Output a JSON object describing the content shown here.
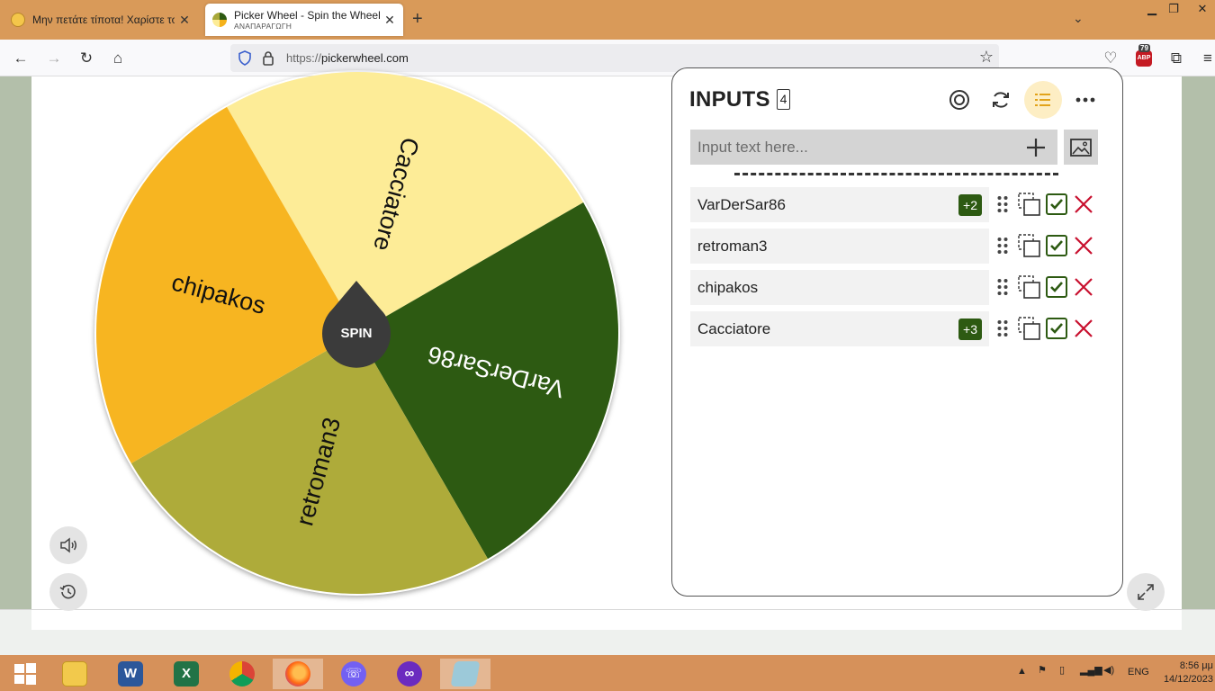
{
  "browser": {
    "tabs": [
      {
        "title": "Μην πετάτε τίποτα! Χαρίστε το",
        "subtitle": ""
      },
      {
        "title": "Picker Wheel - Spin the Wheel t",
        "subtitle": "ΑΝΑΠΑΡΑΓΩΓΗ"
      }
    ],
    "new_tab_label": "+",
    "url_scheme": "https://",
    "url_host": "pickerwheel.com",
    "abp_label": "ABP",
    "abp_count": "79"
  },
  "wheel": {
    "spin_label": "SPIN",
    "segments": [
      {
        "label": "Cacciatore",
        "color": "#fdec97"
      },
      {
        "label": "VarDerSar86",
        "color": "#2d5a12"
      },
      {
        "label": "retroman3",
        "color": "#aeab3a"
      },
      {
        "label": "chipakos",
        "color": "#f7b521"
      }
    ]
  },
  "inputs": {
    "title": "INPUTS",
    "count": "4",
    "placeholder": "Input text here...",
    "entries": [
      {
        "label": "VarDerSar86",
        "weight": "+2"
      },
      {
        "label": "retroman3",
        "weight": ""
      },
      {
        "label": "chipakos",
        "weight": ""
      },
      {
        "label": "Cacciatore",
        "weight": "+3"
      }
    ]
  },
  "taskbar": {
    "language": "ENG",
    "time": "8:56 μμ",
    "date": "14/12/2023"
  },
  "colors": {
    "accent_green": "#2d5a12",
    "delete_red": "#c8102e",
    "active_icon_bg": "#fdeec4"
  }
}
